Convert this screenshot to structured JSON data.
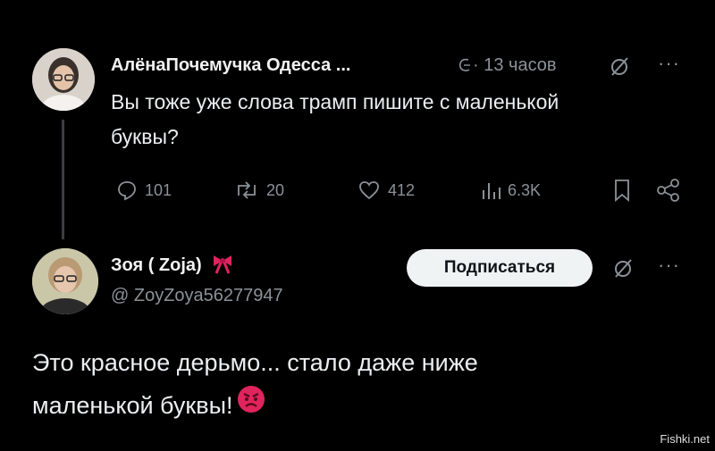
{
  "reply": {
    "author_name": "АлёнаПочемучка Одесса ...",
    "time": "· 13 часов",
    "text_line1": "Вы тоже уже слова трамп  пишите с маленькой",
    "text_line2": "буквы?",
    "actions": {
      "replies": "101",
      "reposts": "20",
      "likes": "412",
      "views": "6.3K"
    }
  },
  "post": {
    "author_name": "Зоя ( Zoja)",
    "handle": "@ ZoyZoya56277947",
    "follow_label": "Подписаться",
    "text_line1": "Это красное дерьмо... стало даже ниже",
    "text_line2": "маленькой буквы!"
  },
  "icons": {
    "reply": "speech-bubble-icon",
    "repost": "repost-icon",
    "like": "heart-icon",
    "views": "bar-chart-icon",
    "bookmark": "bookmark-icon",
    "share": "share-icon",
    "grok": "grok-icon",
    "more": "more-dots-icon",
    "bow": "red-bow-emoji",
    "angry": "angry-face-emoji"
  },
  "colors": {
    "background": "#000000",
    "text": "#e7e9ea",
    "muted": "#8b9298",
    "button": "#eff3f4",
    "bow": "#e0245e"
  },
  "watermark": "Fishki.net"
}
